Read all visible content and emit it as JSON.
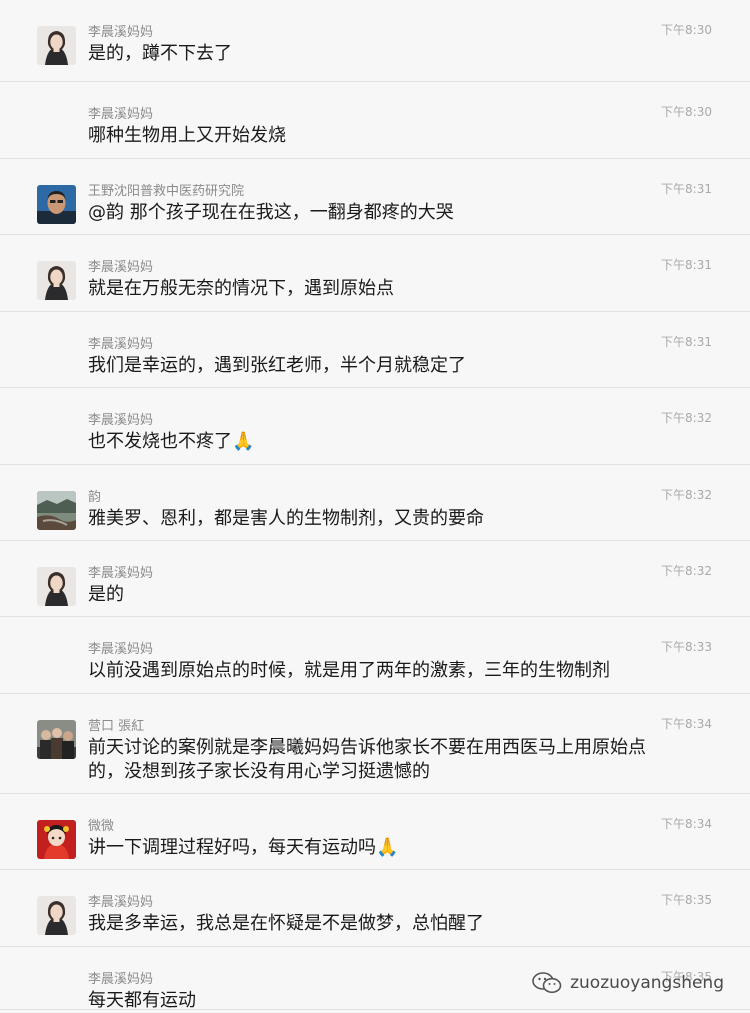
{
  "messages": [
    {
      "sender": "李晨溪妈妈",
      "time": "下午8:30",
      "text": "是的，蹲不下去了",
      "avatar": "woman-avatar"
    },
    {
      "sender": "李晨溪妈妈",
      "time": "下午8:30",
      "text": "哪种生物用上又开始发烧",
      "avatar": ""
    },
    {
      "sender": "王野沈阳普救中医药研究院",
      "time": "下午8:31",
      "text": "@韵 那个孩子现在在我这，一翻身都疼的大哭",
      "avatar": "man-avatar"
    },
    {
      "sender": "李晨溪妈妈",
      "time": "下午8:31",
      "text": "就是在万般无奈的情况下，遇到原始点",
      "avatar": "woman-avatar"
    },
    {
      "sender": "李晨溪妈妈",
      "time": "下午8:31",
      "text": "我们是幸运的，遇到张红老师，半个月就稳定了",
      "avatar": ""
    },
    {
      "sender": "李晨溪妈妈",
      "time": "下午8:32",
      "text": "也不发烧也不疼了🙏",
      "avatar": ""
    },
    {
      "sender": "韵",
      "time": "下午8:32",
      "text": "雅美罗、恩利，都是害人的生物制剂，又贵的要命",
      "avatar": "landscape-avatar"
    },
    {
      "sender": "李晨溪妈妈",
      "time": "下午8:32",
      "text": "是的",
      "avatar": "woman-avatar"
    },
    {
      "sender": "李晨溪妈妈",
      "time": "下午8:33",
      "text": "以前没遇到原始点的时候，就是用了两年的激素，三年的生物制剂",
      "avatar": ""
    },
    {
      "sender": "营口 張紅",
      "time": "下午8:34",
      "text": "前天讨论的案例就是李晨曦妈妈告诉他家长不要在用西医马上用原始点的，没想到孩子家长没有用心学习挺遗憾的",
      "avatar": "group-avatar"
    },
    {
      "sender": "微微",
      "time": "下午8:34",
      "text": "讲一下调理过程好吗，每天有运动吗🙏",
      "avatar": "child-avatar"
    },
    {
      "sender": "李晨溪妈妈",
      "time": "下午8:35",
      "text": "我是多幸运，我总是在怀疑是不是做梦，总怕醒了",
      "avatar": "woman-avatar"
    },
    {
      "sender": "李晨溪妈妈",
      "time": "下午8:35",
      "text": "每天都有运动",
      "avatar": ""
    }
  ],
  "watermark": {
    "text": "zuozuoyangsheng",
    "icon": "wechat-icon"
  }
}
